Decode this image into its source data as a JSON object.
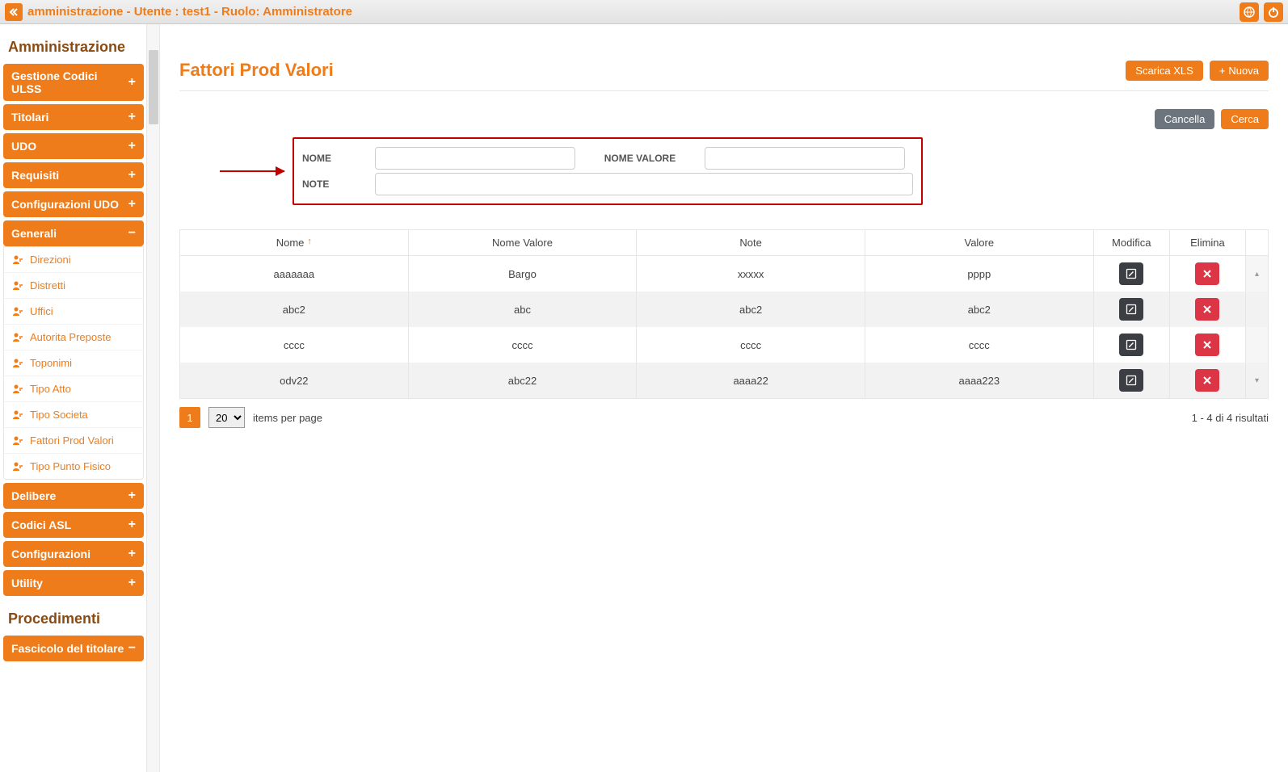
{
  "topbar": {
    "title": "amministrazione - Utente : test1 - Ruolo: Amministratore"
  },
  "sidebar": {
    "heading1": "Amministrazione",
    "heading2": "Procedimenti",
    "items": [
      {
        "label": "Gestione Codici ULSS",
        "icon": "+"
      },
      {
        "label": "Titolari",
        "icon": "+"
      },
      {
        "label": "UDO",
        "icon": "+"
      },
      {
        "label": "Requisiti",
        "icon": "+"
      },
      {
        "label": "Configurazioni UDO",
        "icon": "+"
      },
      {
        "label": "Generali",
        "icon": "−"
      },
      {
        "label": "Delibere",
        "icon": "+"
      },
      {
        "label": "Codici ASL",
        "icon": "+"
      },
      {
        "label": "Configurazioni",
        "icon": "+"
      },
      {
        "label": "Utility",
        "icon": "+"
      },
      {
        "label": "Fascicolo del titolare",
        "icon": "−"
      }
    ],
    "sub": [
      {
        "label": "Direzioni"
      },
      {
        "label": "Distretti"
      },
      {
        "label": "Uffici"
      },
      {
        "label": "Autorita Preposte"
      },
      {
        "label": "Toponimi"
      },
      {
        "label": "Tipo Atto"
      },
      {
        "label": "Tipo Societa"
      },
      {
        "label": "Fattori Prod Valori"
      },
      {
        "label": "Tipo Punto Fisico"
      }
    ]
  },
  "page": {
    "title": "Fattori Prod Valori",
    "scarica": "Scarica XLS",
    "nuova": "Nuova",
    "cancella": "Cancella",
    "cerca": "Cerca"
  },
  "search": {
    "nome_label": "NOME",
    "nome_valore_label": "NOME VALORE",
    "note_label": "NOTE"
  },
  "table": {
    "headers": {
      "nome": "Nome",
      "nome_valore": "Nome Valore",
      "note": "Note",
      "valore": "Valore",
      "modifica": "Modifica",
      "elimina": "Elimina"
    },
    "rows": [
      {
        "nome": "aaaaaaa",
        "nome_valore": "Bargo",
        "note": "xxxxx",
        "valore": "pppp"
      },
      {
        "nome": "abc2",
        "nome_valore": "abc",
        "note": "abc2",
        "valore": "abc2"
      },
      {
        "nome": "cccc",
        "nome_valore": "cccc",
        "note": "cccc",
        "valore": "cccc"
      },
      {
        "nome": "odv22",
        "nome_valore": "abc22",
        "note": "aaaa22",
        "valore": "aaaa223"
      }
    ]
  },
  "pager": {
    "current_page": "1",
    "page_size": "20",
    "items_label": "items per page",
    "summary": "1 - 4 di 4 risultati"
  }
}
